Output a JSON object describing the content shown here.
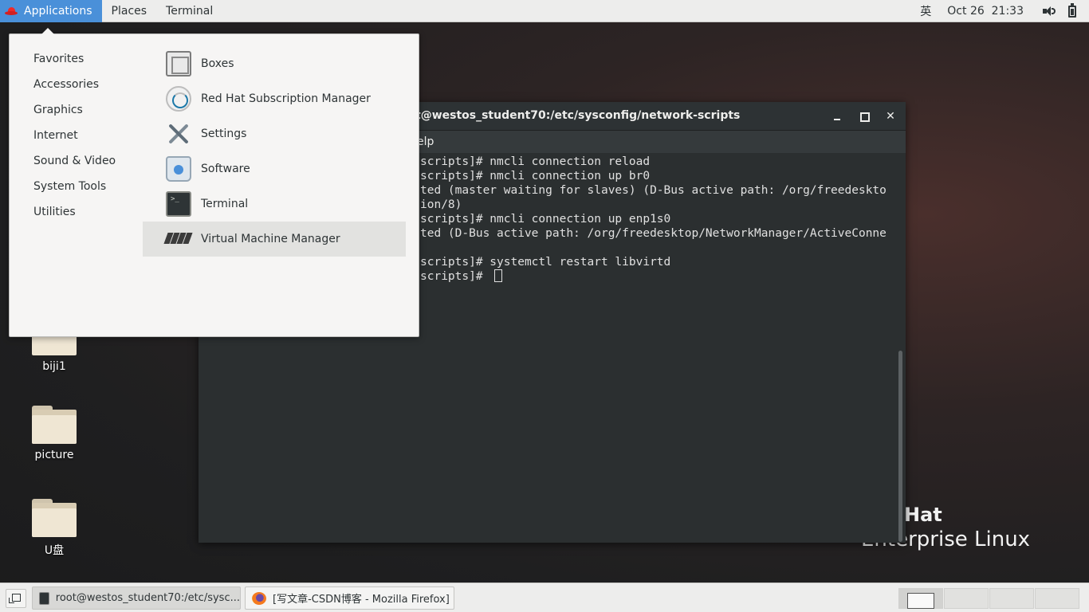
{
  "topbar": {
    "applications": "Applications",
    "places": "Places",
    "terminal": "Terminal",
    "input_method": "英",
    "clock": "Oct 26  21:33",
    "icons": [
      "redhat-icon",
      "speaker-icon",
      "battery-icon"
    ]
  },
  "app_menu": {
    "categories": [
      "Favorites",
      "Accessories",
      "Graphics",
      "Internet",
      "Sound & Video",
      "System Tools",
      "Utilities"
    ],
    "apps": [
      "Boxes",
      "Red Hat Subscription Manager",
      "Settings",
      "Software",
      "Terminal",
      "Virtual Machine Manager"
    ],
    "highlighted": "Virtual Machine Manager"
  },
  "desktop": {
    "icons": [
      "biji1",
      "picture",
      "U盘"
    ]
  },
  "terminal_window": {
    "title": "t@westos_student70:/etc/sysconfig/network-scripts",
    "menu_visible": "elp",
    "lines": [
      "scripts]# nmcli connection reload",
      "scripts]# nmcli connection up br0",
      "ted (master waiting for slaves) (D-Bus active path: /org/freedeskto",
      "ion/8)",
      "scripts]# nmcli connection up enp1s0",
      "ted (D-Bus active path: /org/freedesktop/NetworkManager/ActiveConne",
      "",
      "scripts]# systemctl restart libvirtd",
      "scripts]# "
    ],
    "buttons": {
      "minimize": "minimize",
      "maximize": "maximize",
      "close": "✕"
    }
  },
  "watermark": {
    "line1": "Hat",
    "line2": "Enterprise Linux"
  },
  "taskbar": {
    "tasks": [
      {
        "label": "root@westos_student70:/etc/sysc...",
        "icon": "terminal-icon"
      },
      {
        "label": "[写文章-CSDN博客 - Mozilla Firefox]",
        "icon": "firefox-icon"
      }
    ],
    "workspaces": 4
  }
}
